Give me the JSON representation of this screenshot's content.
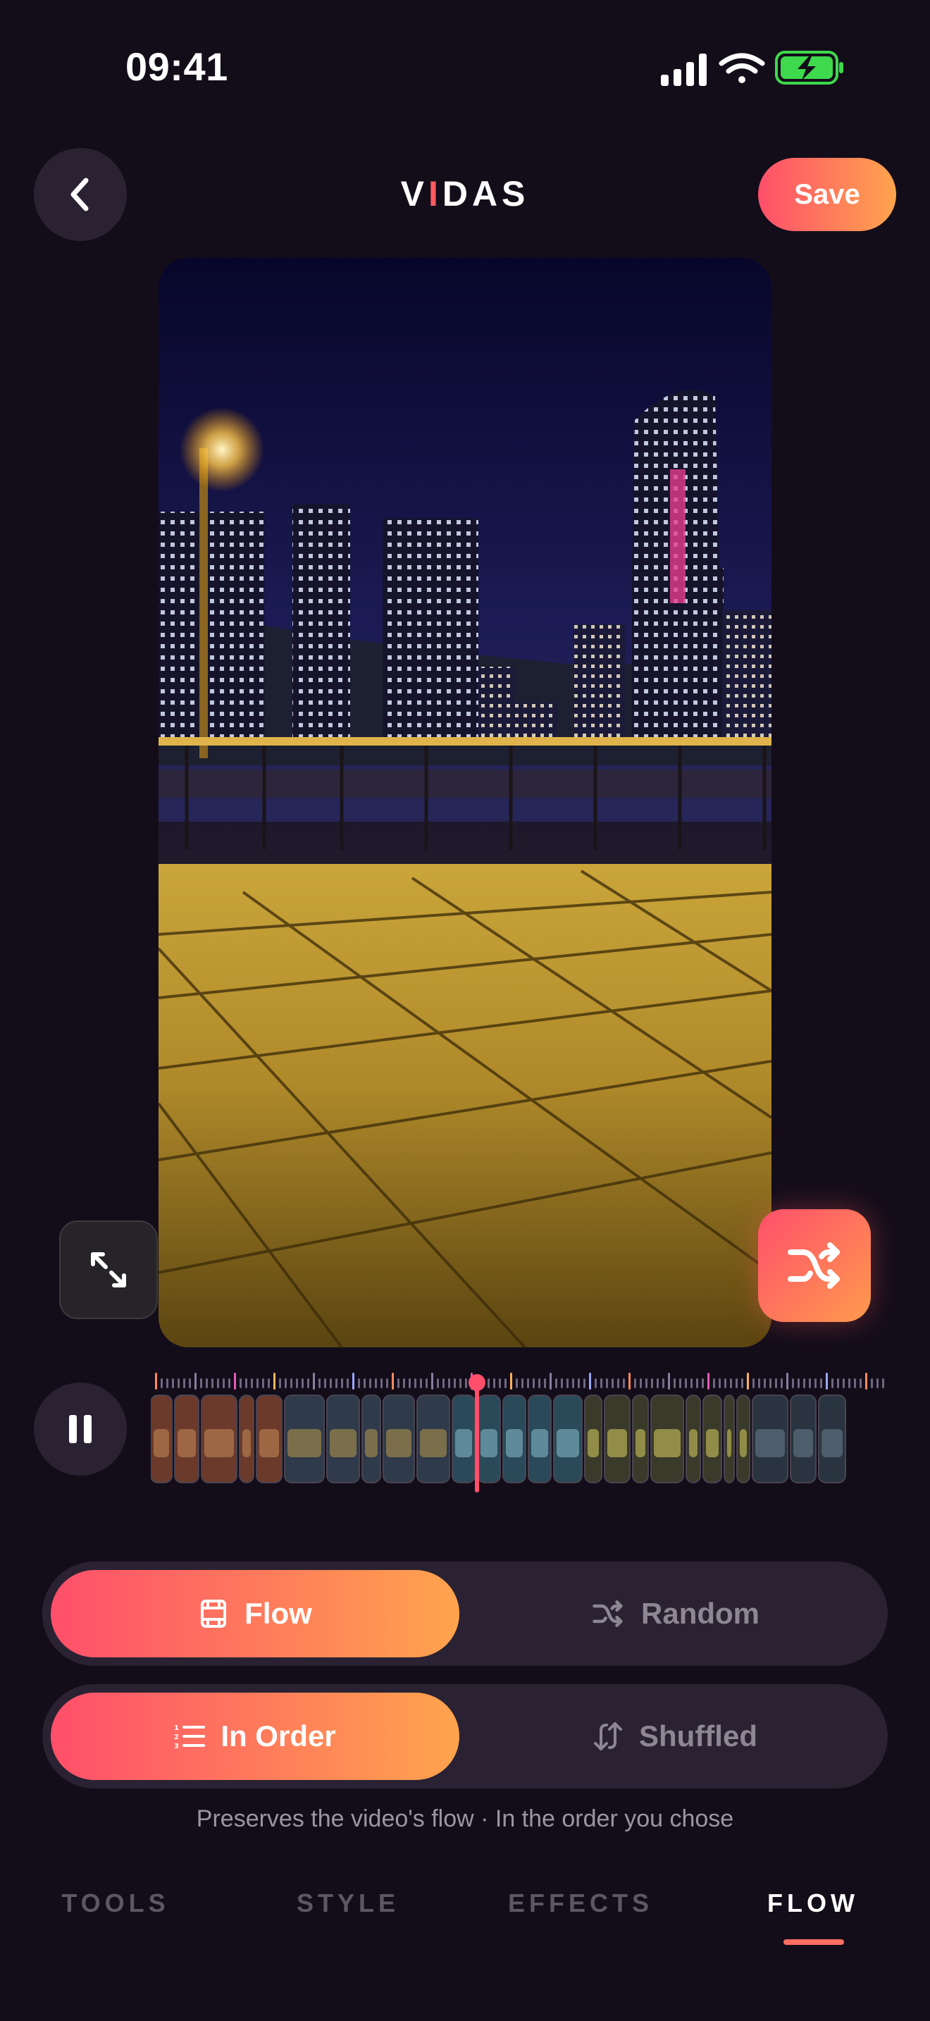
{
  "status_bar": {
    "time": "09:41"
  },
  "header": {
    "logo_pre": "V",
    "logo_accent": "I",
    "logo_post": "DAS",
    "save_label": "Save"
  },
  "flow_mode": {
    "selected": "Flow",
    "options": [
      "Flow",
      "Random"
    ]
  },
  "order_mode": {
    "selected": "In Order",
    "options": [
      "In Order",
      "Shuffled"
    ]
  },
  "caption": "Preserves the video's flow · In the order you chose",
  "tabs": [
    {
      "label": "TOOLS",
      "active": false
    },
    {
      "label": "STYLE",
      "active": false
    },
    {
      "label": "EFFECTS",
      "active": false
    },
    {
      "label": "FLOW",
      "active": true
    }
  ],
  "colors": {
    "accent_start": "#ff4f6b",
    "accent_end": "#ffa44d",
    "background": "#130d1a",
    "surface": "#2a2232"
  },
  "icons": {
    "back": "chevron-left-icon",
    "expand": "expand-arrows-icon",
    "shuffle": "shuffle-icon",
    "pause": "pause-icon",
    "flow": "film-icon",
    "random": "shuffle-icon",
    "in_order": "numbered-list-icon",
    "shuffled": "arrows-up-down-icon"
  }
}
